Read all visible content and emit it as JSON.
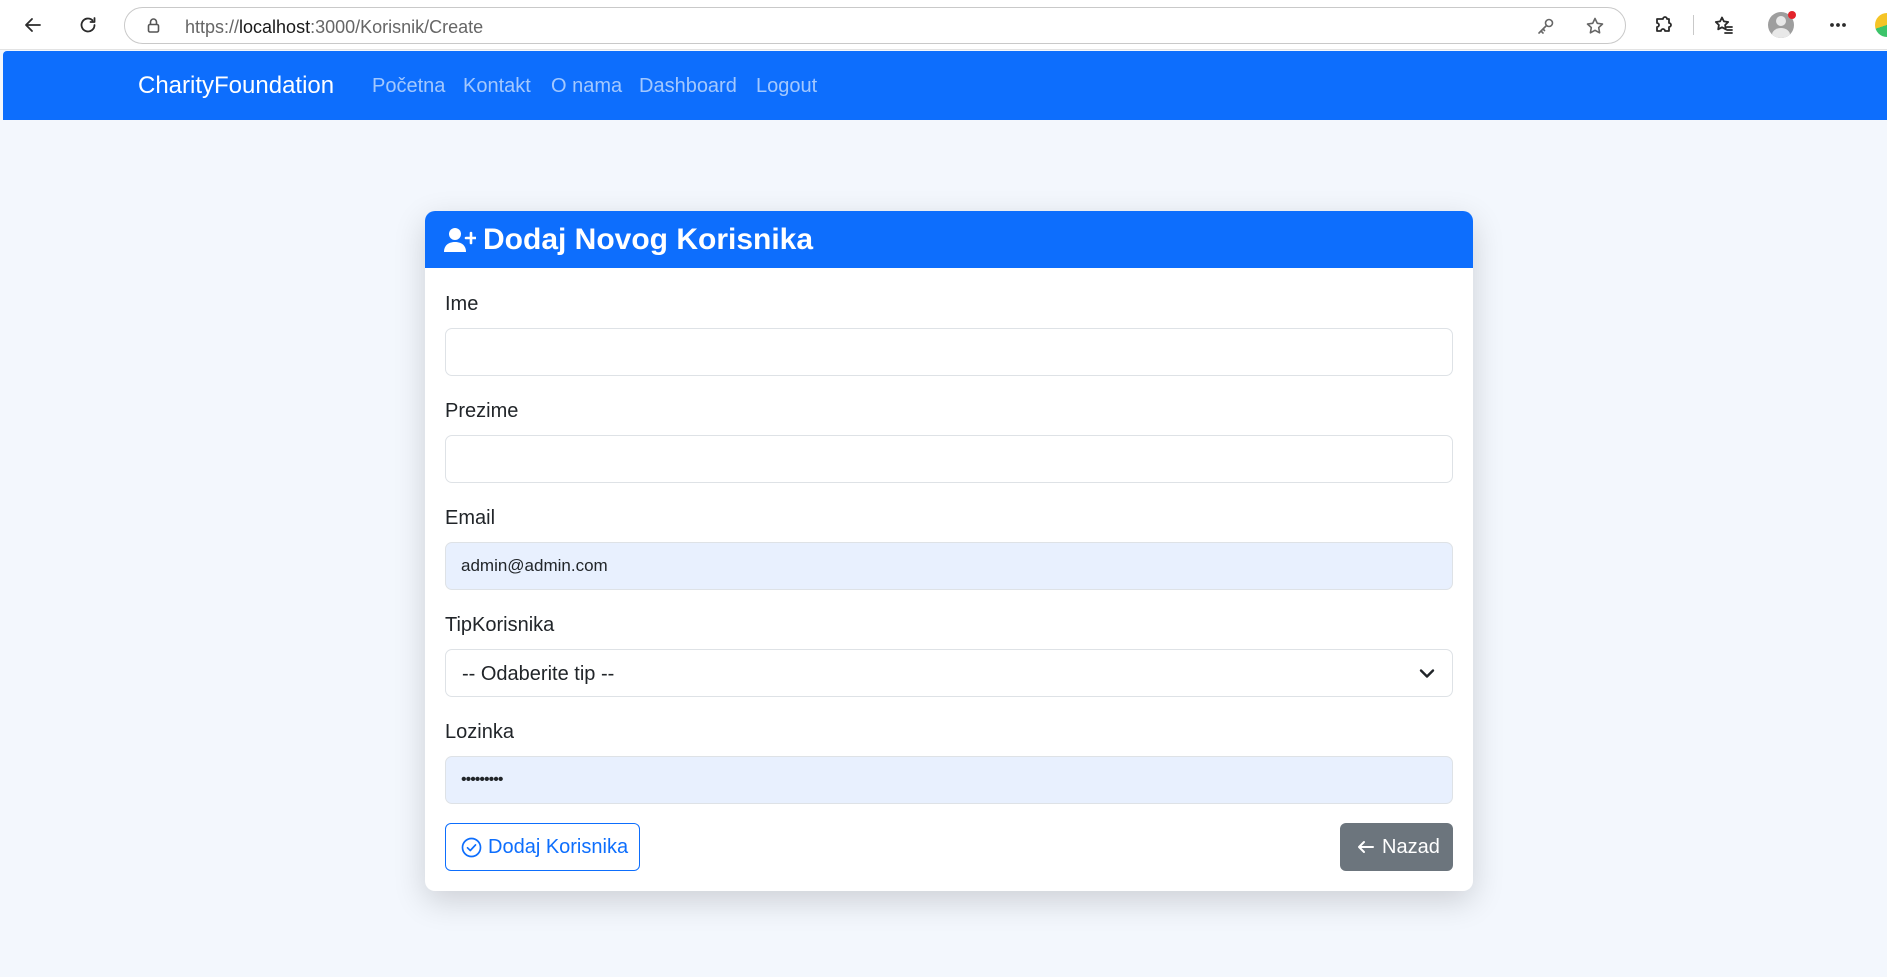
{
  "browser": {
    "url_prefix": "https://",
    "url_host": "localhost",
    "url_rest": ":3000/Korisnik/Create",
    "icons": [
      "back-icon",
      "refresh-icon",
      "lock-icon",
      "key-icon",
      "star-icon",
      "extensions-icon",
      "favorites-icon",
      "profile-icon",
      "more-icon"
    ]
  },
  "navbar": {
    "brand": "CharityFoundation",
    "links": [
      "Početna",
      "Kontakt",
      "O nama",
      "Dashboard",
      "Logout"
    ],
    "color": "#0d6efd"
  },
  "card": {
    "title": "Dodaj Novog Korisnika",
    "title_icon": "user-plus-icon"
  },
  "form": {
    "ime_label": "Ime",
    "ime_value": "",
    "prezime_label": "Prezime",
    "prezime_value": "",
    "email_label": "Email",
    "email_value": "admin@admin.com",
    "tip_label": "TipKorisnika",
    "tip_value": "-- Odaberite tip --",
    "lozinka_label": "Lozinka",
    "lozinka_value": "•••••••••"
  },
  "buttons": {
    "submit_label": "Dodaj Korisnika",
    "submit_icon": "check-circle-icon",
    "back_label": "Nazad",
    "back_icon": "arrow-left-icon",
    "primary_color": "#0d6efd",
    "secondary_color": "#6c757d"
  }
}
